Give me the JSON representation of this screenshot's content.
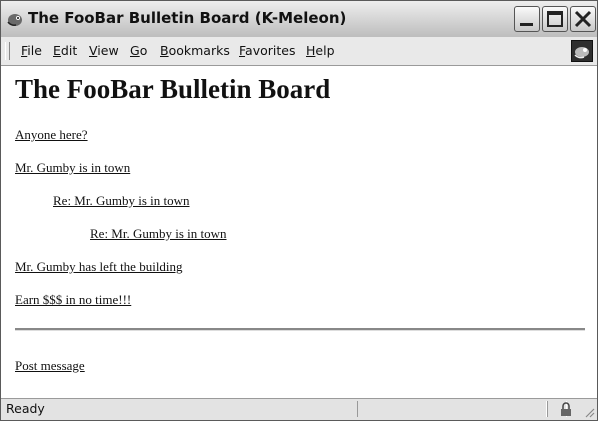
{
  "window": {
    "title": "The FooBar Bulletin Board (K-Meleon)"
  },
  "menu": {
    "items": [
      "File",
      "Edit",
      "View",
      "Go",
      "Bookmarks",
      "Favorites",
      "Help"
    ]
  },
  "page": {
    "heading": "The FooBar Bulletin Board",
    "posts": [
      {
        "title": "Anyone here?",
        "level": 0
      },
      {
        "title": "Mr. Gumby is in town",
        "level": 0
      },
      {
        "title": "Re: Mr. Gumby is in town",
        "level": 1
      },
      {
        "title": "Re: Mr. Gumby is in town",
        "level": 2
      },
      {
        "title": "Mr. Gumby has left the building",
        "level": 0
      },
      {
        "title": "Earn $$$ in no time!!!",
        "level": 0
      }
    ],
    "post_message_label": "Post message"
  },
  "status": {
    "text": "Ready"
  },
  "icons": {
    "app": "k-meleon-app-icon",
    "minimize": "minimize-icon",
    "maximize": "maximize-icon",
    "close": "close-icon",
    "throbber": "throbber-icon",
    "security": "lock-icon"
  }
}
